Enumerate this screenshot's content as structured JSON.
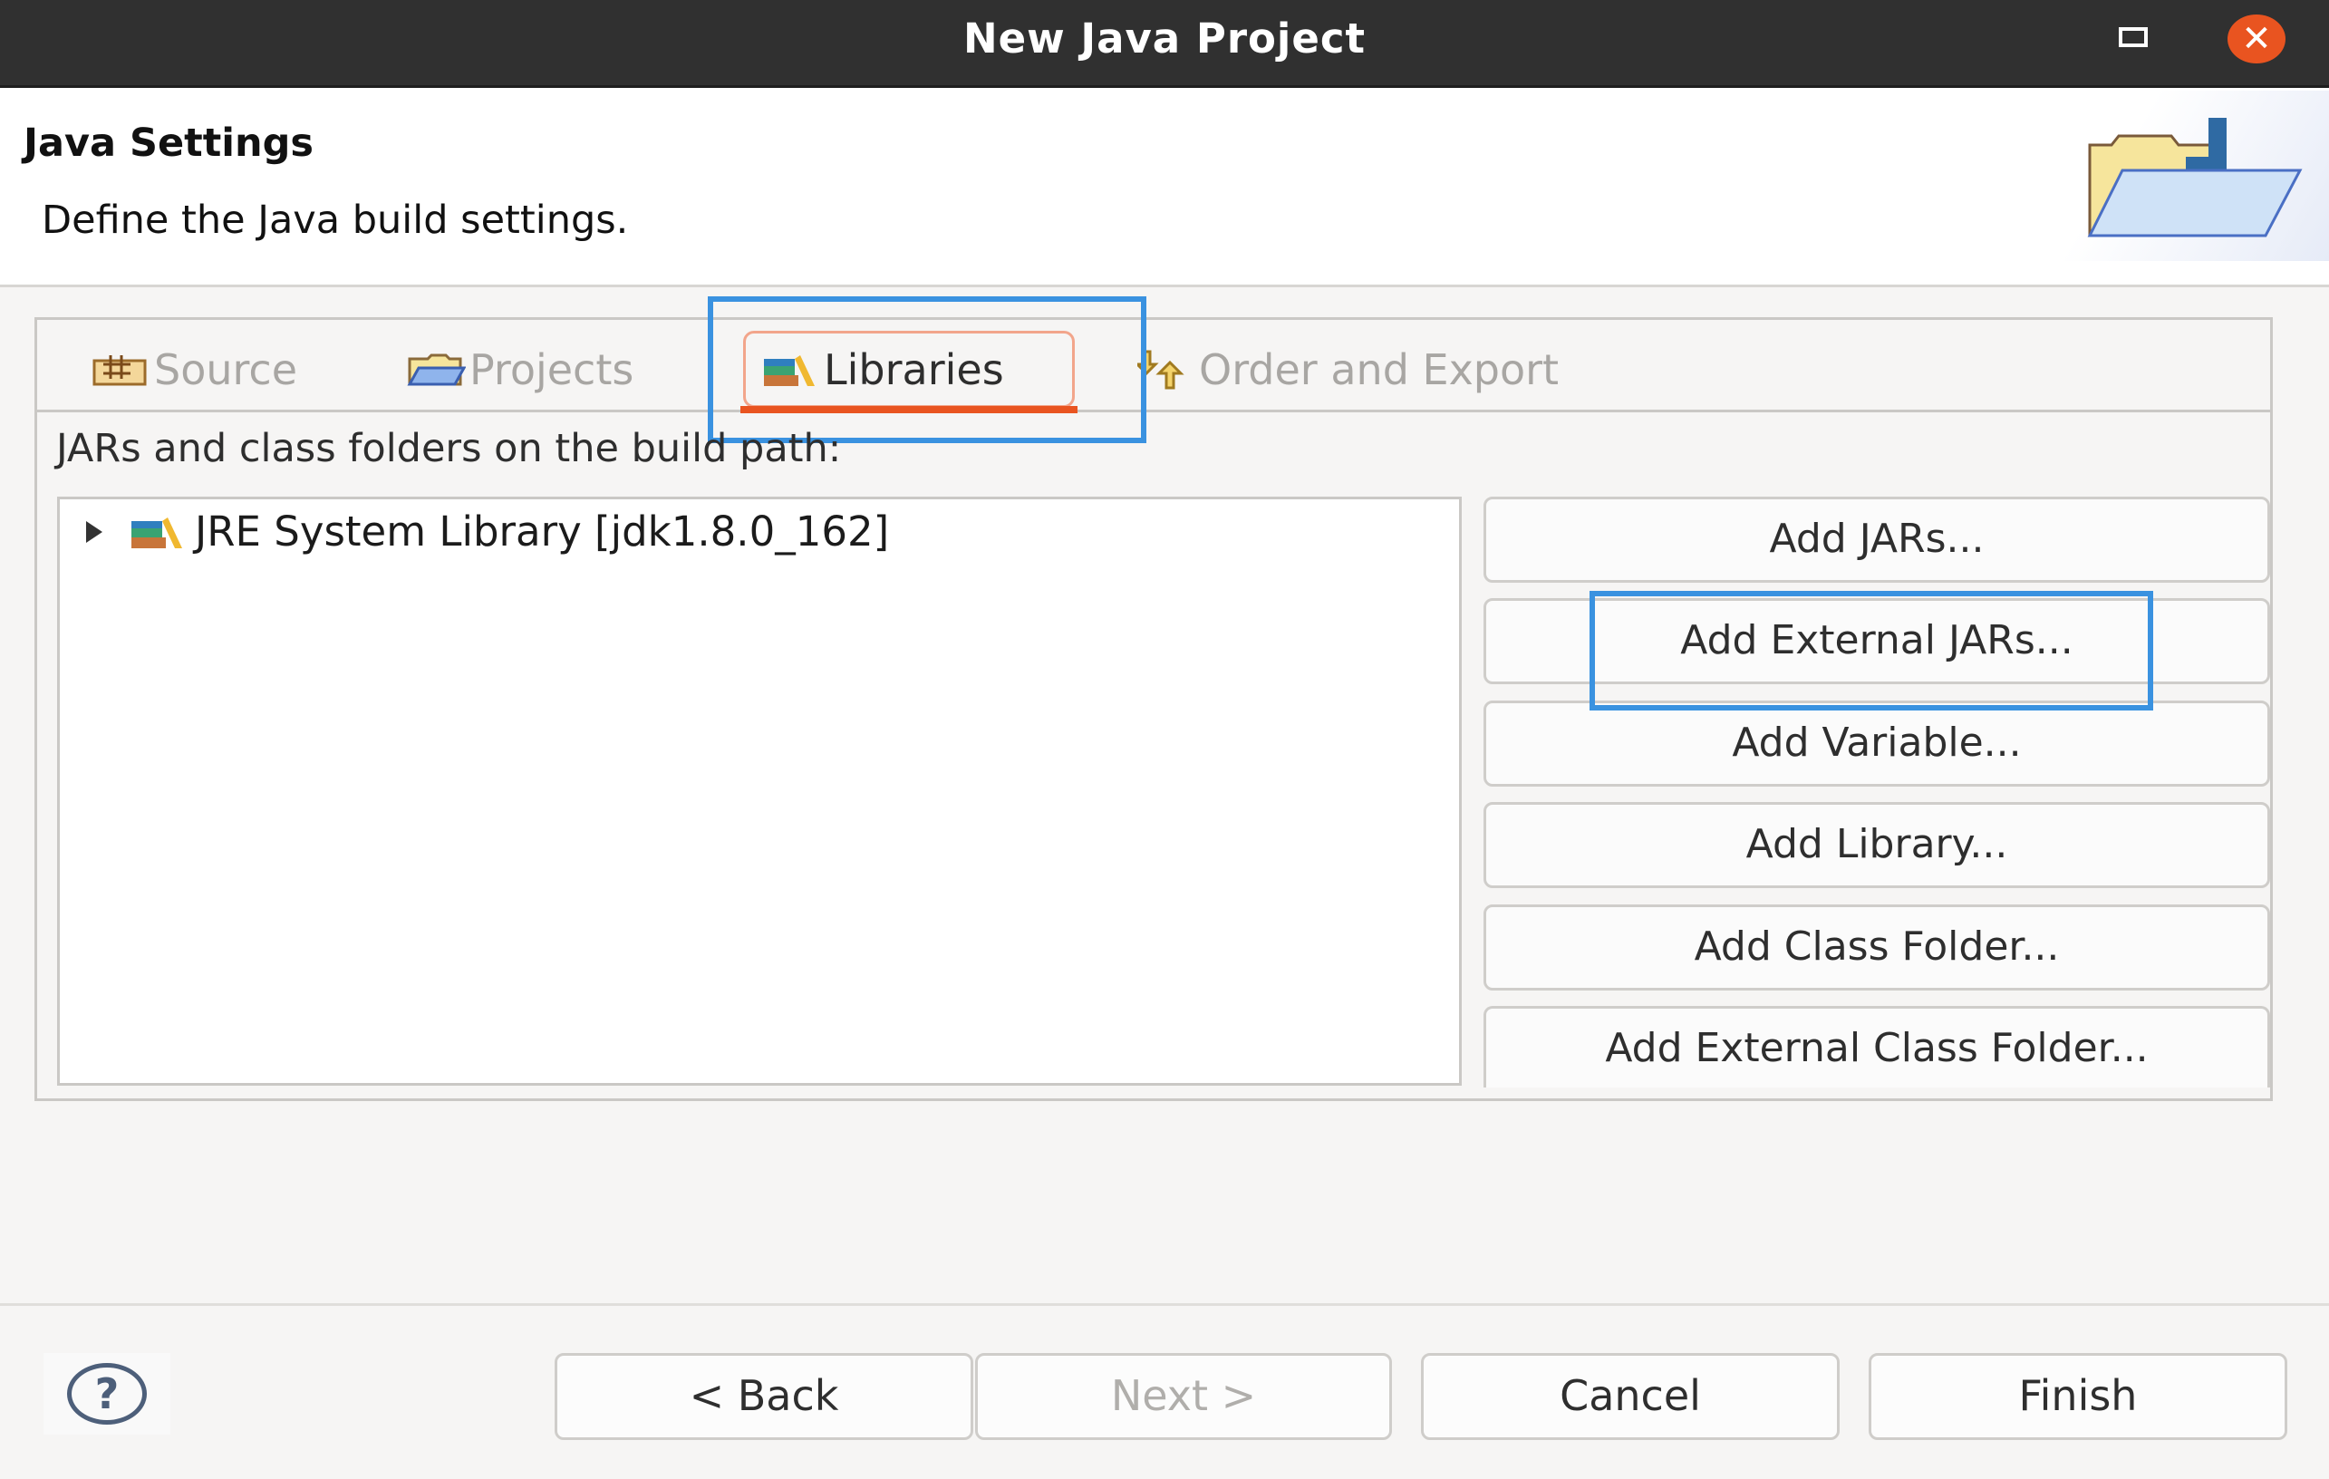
{
  "window": {
    "title": "New Java Project",
    "maximize_icon": "maximize-icon",
    "close_icon": "close-icon",
    "close_glyph": "✕"
  },
  "header": {
    "title": "Java Settings",
    "description": "Define the Java build settings.",
    "banner_icon": "new-java-project-folder-icon"
  },
  "tabs": [
    {
      "label": "Source",
      "icon": "source-folder-icon",
      "active": false
    },
    {
      "label": "Projects",
      "icon": "projects-folder-icon",
      "active": false
    },
    {
      "label": "Libraries",
      "icon": "libraries-icon",
      "active": true
    },
    {
      "label": "Order and Export",
      "icon": "order-export-arrows-icon",
      "active": false
    }
  ],
  "libraries": {
    "description": "JARs and class folders on the build path:",
    "tree_items": [
      {
        "label": "JRE System Library [jdk1.8.0_162]",
        "icon": "library-icon",
        "expanded": false
      }
    ],
    "buttons": [
      {
        "label": "Add JARs..."
      },
      {
        "label": "Add External JARs...",
        "highlighted": true
      },
      {
        "label": "Add Variable..."
      },
      {
        "label": "Add Library..."
      },
      {
        "label": "Add Class Folder..."
      },
      {
        "label": "Add External Class Folder..."
      }
    ]
  },
  "footer": {
    "help_glyph": "?",
    "back": "< Back",
    "next": "Next >",
    "next_enabled": false,
    "cancel": "Cancel",
    "finish": "Finish"
  },
  "colors": {
    "accent": "#e95420",
    "highlight_box": "#3a92e0",
    "titlebar": "#303030"
  }
}
